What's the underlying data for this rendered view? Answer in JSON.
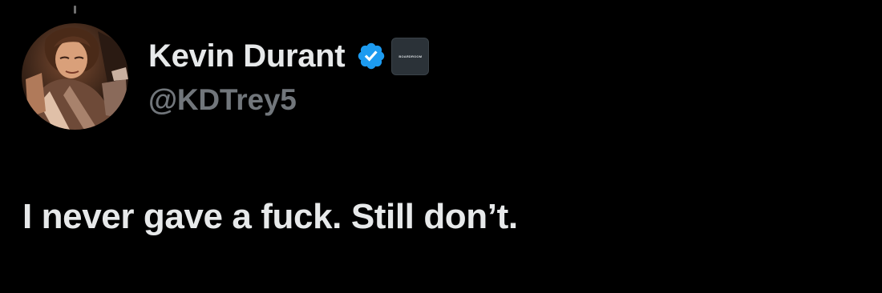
{
  "tweet": {
    "author": {
      "display_name": "Kevin Durant",
      "handle": "@KDTrey5",
      "verified_icon": "verified-badge-icon",
      "verified_color": "#1d9bf0",
      "affiliate_label": "BOARDROOM",
      "avatar": "profile-avatar"
    },
    "text": "I never gave a fuck. Still don’t."
  },
  "theme": {
    "background": "#000000",
    "primary_text": "#e7e9ea",
    "secondary_text": "#71767b"
  }
}
